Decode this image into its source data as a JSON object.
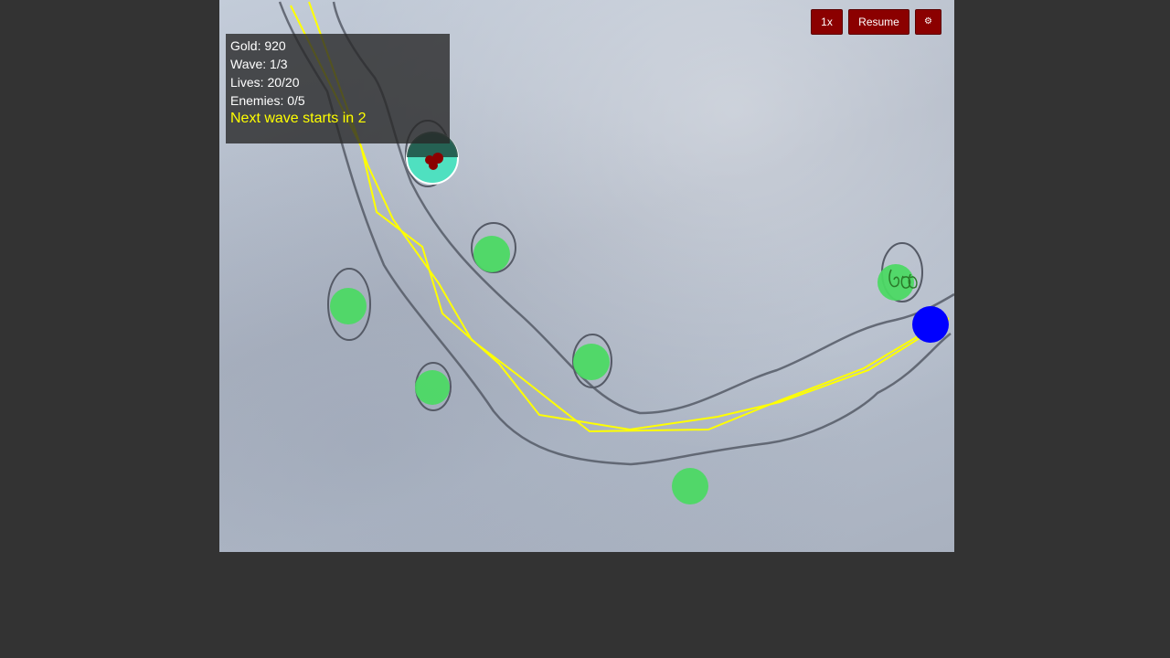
{
  "hud": {
    "gold": "Gold: 920",
    "wave": "Wave: 1/3",
    "lives": "Lives: 20/20",
    "enemies": "Enemies: 0/5",
    "next_wave": "Next wave starts in 2"
  },
  "controls": {
    "speed_label": "1x",
    "resume_label": "Resume",
    "settings_icon": "gear-icon",
    "settings_glyph": "⚙"
  },
  "colors": {
    "button_bg": "#8b0000",
    "path_line": "#ffff00",
    "tower_slot": "#4cd964",
    "selected_tower": "#4fe0c0",
    "enemy": "#0000ff",
    "hud_bg": "#282828"
  }
}
